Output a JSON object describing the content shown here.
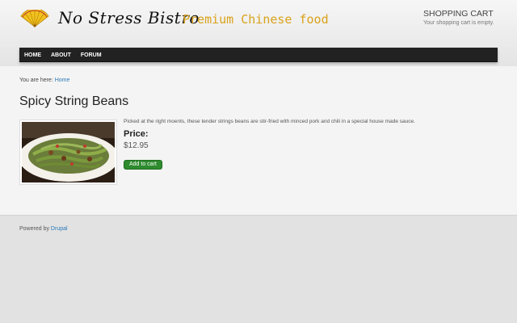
{
  "header": {
    "site_name": "No Stress Bistro",
    "slogan": "Premium Chinese food",
    "logo_icon": "folding-fan-icon"
  },
  "cart": {
    "title": "SHOPPING CART",
    "text": "Your shopping cart is empty."
  },
  "nav": {
    "items": [
      {
        "label": "HOME"
      },
      {
        "label": "ABOUT"
      },
      {
        "label": "FORUM"
      }
    ]
  },
  "breadcrumb": {
    "prefix": "You are here:",
    "home": "Home"
  },
  "product": {
    "title": "Spicy String Beans",
    "description": "Picked at the right moents, these tender strings beans are stir-fried with minced pork and chili in a special house made sauce.",
    "price_label": "Price:",
    "price_value": "$12.95",
    "add_to_cart": "Add to cart",
    "image_icon": "food-photo"
  },
  "footer": {
    "powered_prefix": "Powered by",
    "powered_link": "Drupal"
  },
  "colors": {
    "slogan": "#d9a21a",
    "nav_bg": "#222222",
    "link": "#2a7ab8",
    "button": "#2e8b2e"
  }
}
